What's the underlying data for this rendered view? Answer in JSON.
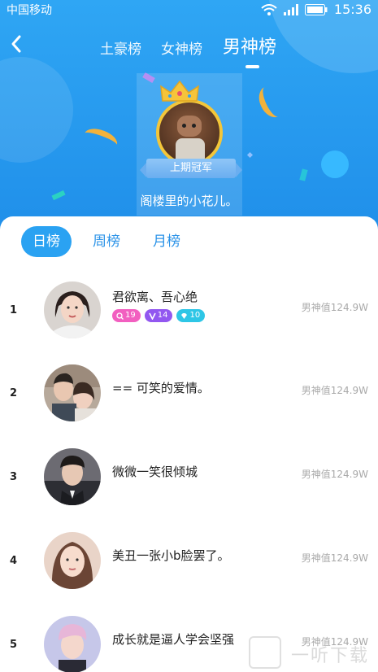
{
  "status_bar": {
    "carrier": "中国移动",
    "time": "15:36"
  },
  "nav": {
    "tabs": [
      {
        "label": "土豪榜",
        "active": false
      },
      {
        "label": "女神榜",
        "active": false
      },
      {
        "label": "男神榜",
        "active": true
      }
    ]
  },
  "champion": {
    "ribbon_label": "上期冠军",
    "name": "阁楼里的小花儿。"
  },
  "period_tabs": [
    {
      "label": "日榜",
      "active": true
    },
    {
      "label": "周榜",
      "active": false
    },
    {
      "label": "月榜",
      "active": false
    }
  ],
  "rankings": [
    {
      "rank": "1",
      "name": "君欲离、吾心绝",
      "score": "男神值124.9W",
      "badges": [
        {
          "icon": "search-icon",
          "value": "19",
          "color": "#f25fc0"
        },
        {
          "icon": "v-icon",
          "value": "14",
          "color": "#9257f0"
        },
        {
          "icon": "diamond-icon",
          "value": "10",
          "color": "#2ec6e6"
        }
      ]
    },
    {
      "rank": "2",
      "name": "== 可笑的爱情。",
      "score": "男神值124.9W",
      "badges": []
    },
    {
      "rank": "3",
      "name": "微微一笑很倾城",
      "score": "男神值124.9W",
      "badges": []
    },
    {
      "rank": "4",
      "name": "美丑一张小b脸罢了。",
      "score": "男神值124.9W",
      "badges": []
    },
    {
      "rank": "5",
      "name": "成长就是逼人学会坚强",
      "score": "男神值124.9W",
      "badges": []
    }
  ],
  "watermark": {
    "text": "一听下载"
  },
  "colors": {
    "primary": "#2aa2f2",
    "header": "#1f8ee9",
    "gold": "#f3c63a"
  }
}
